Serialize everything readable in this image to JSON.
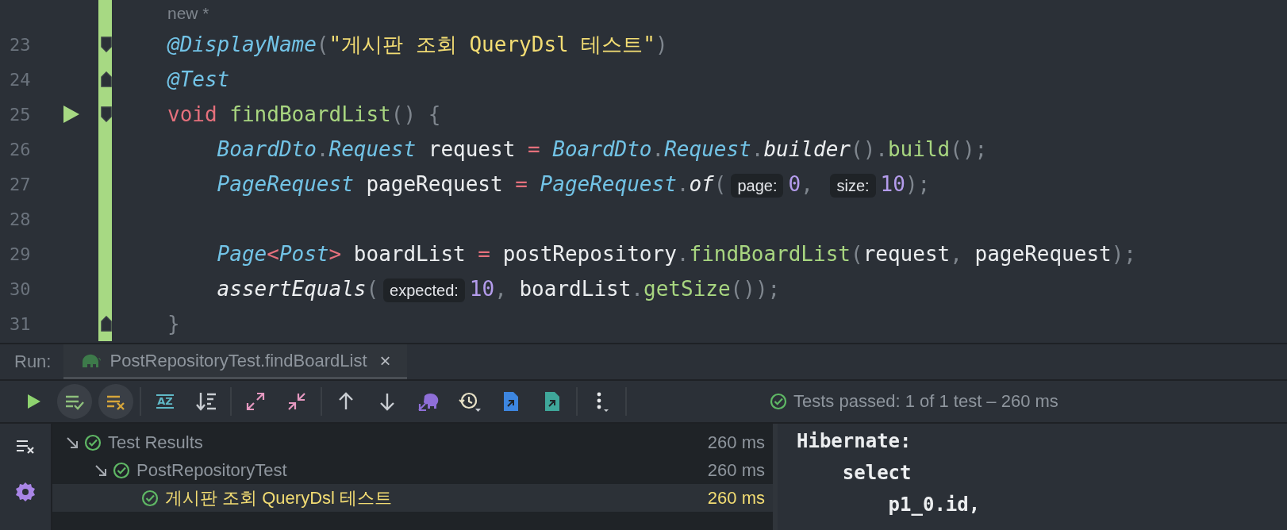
{
  "editor": {
    "author_hint": "new *",
    "lines": [
      {
        "number": "23",
        "fold_open": true,
        "run": false,
        "tokens": [
          {
            "kind": "annot",
            "text": "@DisplayName"
          },
          {
            "kind": "punct",
            "text": "("
          },
          {
            "kind": "str",
            "text": "\"게시판 조회 QueryDsl 테스트\""
          },
          {
            "kind": "punct",
            "text": ")"
          }
        ]
      },
      {
        "number": "24",
        "fold_open": false,
        "run": false,
        "tokens": [
          {
            "kind": "annot",
            "text": "@Test"
          }
        ]
      },
      {
        "number": "25",
        "fold_open": true,
        "run": true,
        "tokens": [
          {
            "kind": "kw",
            "text": "void "
          },
          {
            "kind": "method",
            "text": "findBoardList"
          },
          {
            "kind": "punct",
            "text": "() {"
          }
        ],
        "children": [
          {
            "number": "26",
            "tokens": [
              {
                "kind": "type",
                "text": "BoardDto"
              },
              {
                "kind": "punct",
                "text": "."
              },
              {
                "kind": "type",
                "text": "Request"
              },
              {
                "kind": "ident",
                "text": " request "
              },
              {
                "kind": "op",
                "text": "="
              },
              {
                "kind": "type",
                "text": " BoardDto"
              },
              {
                "kind": "punct",
                "text": "."
              },
              {
                "kind": "type",
                "text": "Request"
              },
              {
                "kind": "punct",
                "text": "."
              },
              {
                "kind": "static",
                "text": "builder"
              },
              {
                "kind": "punct",
                "text": "()."
              },
              {
                "kind": "method",
                "text": "build"
              },
              {
                "kind": "punct",
                "text": "();"
              }
            ]
          },
          {
            "number": "27",
            "tokens": [
              {
                "kind": "type",
                "text": "PageRequest"
              },
              {
                "kind": "ident",
                "text": " pageRequest "
              },
              {
                "kind": "op",
                "text": "="
              },
              {
                "kind": "type",
                "text": " PageRequest"
              },
              {
                "kind": "punct",
                "text": "."
              },
              {
                "kind": "static",
                "text": "of"
              },
              {
                "kind": "punct",
                "text": "("
              },
              {
                "kind": "hint",
                "text": "page:"
              },
              {
                "kind": "num",
                "text": "0"
              },
              {
                "kind": "punct",
                "text": ", "
              },
              {
                "kind": "hint",
                "text": "size:"
              },
              {
                "kind": "num",
                "text": "10"
              },
              {
                "kind": "punct",
                "text": ");"
              }
            ]
          },
          {
            "number": "28"
          },
          {
            "number": "29",
            "tokens": [
              {
                "kind": "type",
                "text": "Page"
              },
              {
                "kind": "op",
                "text": "<"
              },
              {
                "kind": "type",
                "text": "Post"
              },
              {
                "kind": "op",
                "text": ">"
              },
              {
                "kind": "ident",
                "text": " boardList "
              },
              {
                "kind": "op",
                "text": "="
              },
              {
                "kind": "ident",
                "text": " postRepository"
              },
              {
                "kind": "punct",
                "text": "."
              },
              {
                "kind": "method",
                "text": "findBoardList"
              },
              {
                "kind": "punct",
                "text": "("
              },
              {
                "kind": "ident",
                "text": "request"
              },
              {
                "kind": "punct",
                "text": ", "
              },
              {
                "kind": "ident",
                "text": "pageRequest"
              },
              {
                "kind": "punct",
                "text": ");"
              }
            ]
          },
          {
            "number": "30",
            "tokens": [
              {
                "kind": "static",
                "text": "assertEquals"
              },
              {
                "kind": "punct",
                "text": "("
              },
              {
                "kind": "hint",
                "text": "expected:"
              },
              {
                "kind": "num",
                "text": "10"
              },
              {
                "kind": "punct",
                "text": ","
              },
              {
                "kind": "ident",
                "text": " boardList"
              },
              {
                "kind": "punct",
                "text": "."
              },
              {
                "kind": "method",
                "text": "getSize"
              },
              {
                "kind": "punct",
                "text": "());"
              }
            ]
          }
        ]
      },
      {
        "number": "31",
        "fold_open": false,
        "run": false,
        "tokens": [
          {
            "kind": "punct",
            "text": "}"
          }
        ]
      }
    ]
  },
  "run_panel": {
    "label": "Run:",
    "tabs": [
      {
        "title": "PostRepositoryTest.findBoardList",
        "close": "×",
        "selected": true
      }
    ],
    "toolbar": [
      [
        {
          "kind": "run",
          "on": false
        },
        {
          "kind": "show-passed",
          "on": true
        },
        {
          "kind": "show-ignored",
          "on": true
        }
      ],
      [
        {
          "kind": "sort-alpha",
          "glyph": "AZ",
          "on": false
        },
        {
          "kind": "sort-duration",
          "on": false
        }
      ],
      [
        {
          "kind": "expand",
          "on": false
        },
        {
          "kind": "collapse",
          "on": false
        }
      ],
      [
        {
          "kind": "up",
          "on": false
        },
        {
          "kind": "down",
          "on": false
        },
        {
          "kind": "elephant",
          "on": false
        },
        {
          "kind": "history",
          "on": false
        },
        {
          "kind": "export",
          "on": false
        },
        {
          "kind": "import",
          "on": false
        }
      ],
      [
        {
          "kind": "more",
          "on": false
        }
      ]
    ],
    "status": {
      "passed": true,
      "text": "Tests passed: 1 of 1 test – 260 ms"
    },
    "side_tools": [
      {
        "kind": "clear"
      },
      {
        "kind": "settings"
      }
    ],
    "tree": [
      {
        "label": "Test Results",
        "duration": "260 ms",
        "passed": true,
        "expanded": true,
        "selected": false,
        "children": [
          {
            "label": "PostRepositoryTest",
            "duration": "260 ms",
            "passed": true,
            "expanded": true,
            "selected": false,
            "children": [
              {
                "label": "게시판 조회 QueryDsl 테스트",
                "duration": "260 ms",
                "passed": true,
                "selected": true
              }
            ]
          }
        ]
      }
    ],
    "console": [
      {
        "text": "Hibernate:",
        "children": [
          {
            "text": "select",
            "children": [
              {
                "text": "p1_0.id,"
              }
            ]
          }
        ]
      }
    ]
  }
}
